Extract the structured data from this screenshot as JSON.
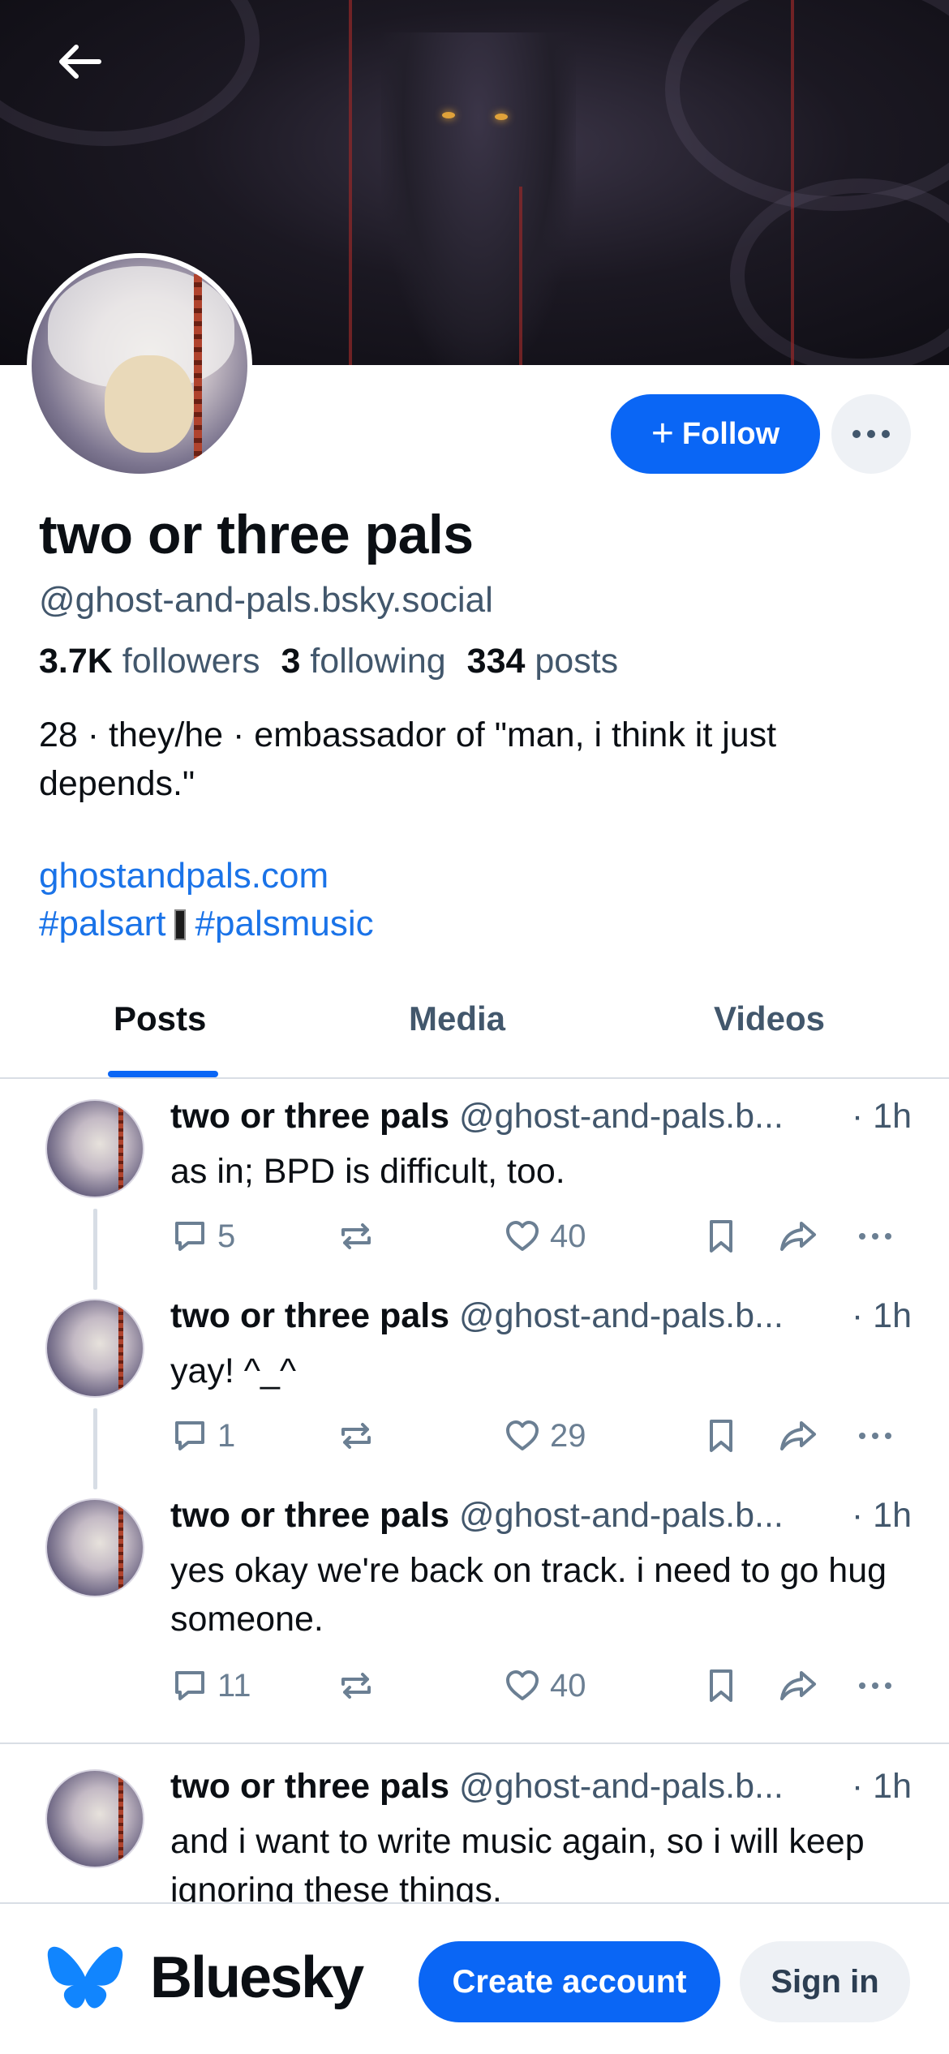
{
  "profile": {
    "display_name": "two or three pals",
    "handle": "@ghost-and-pals.bsky.social",
    "followers_count": "3.7K",
    "followers_label": "followers",
    "following_count": "3",
    "following_label": "following",
    "posts_count": "334",
    "posts_label": "posts",
    "bio": "28 · they/he · embassador of \"man, i think it just depends.\"",
    "link": "ghostandpals.com",
    "tag1": "#palsart",
    "tag2": "#palsmusic"
  },
  "actions": {
    "follow_label": "Follow",
    "more_icon": "ellipsis-icon",
    "back_icon": "arrow-left-icon"
  },
  "tabs": [
    {
      "label": "Posts",
      "active": true
    },
    {
      "label": "Media",
      "active": false
    },
    {
      "label": "Videos",
      "active": false
    }
  ],
  "posts": [
    {
      "name": "two or three pals",
      "handle": "@ghost-and-pals.b...",
      "time": "· 1h",
      "text": "as in; BPD is difficult, too.",
      "replies": "5",
      "likes": "40"
    },
    {
      "name": "two or three pals",
      "handle": "@ghost-and-pals.b...",
      "time": "· 1h",
      "text": "yay! ^_^",
      "replies": "1",
      "likes": "29"
    },
    {
      "name": "two or three pals",
      "handle": "@ghost-and-pals.b...",
      "time": "· 1h",
      "text": "yes okay we're back on track. i need to go hug someone.",
      "replies": "11",
      "likes": "40"
    },
    {
      "name": "two or three pals",
      "handle": "@ghost-and-pals.b...",
      "time": "· 1h",
      "text": "and i want to write music again, so i will keep ignoring these things."
    }
  ],
  "bottom_bar": {
    "brand": "Bluesky",
    "create_account": "Create account",
    "sign_in": "Sign in"
  },
  "colors": {
    "accent": "#0a66f5",
    "link": "#1a73e8",
    "muted": "#42576c"
  }
}
